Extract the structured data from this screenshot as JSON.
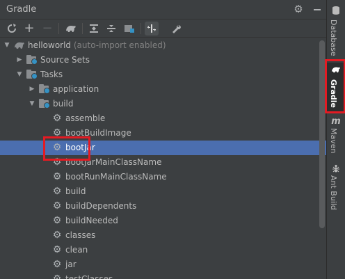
{
  "panel": {
    "title": "Gradle"
  },
  "toolbar": {
    "buttons": [
      {
        "name": "refresh-icon",
        "glyph": "⟳"
      },
      {
        "name": "add-icon",
        "glyph": "+"
      },
      {
        "name": "remove-icon",
        "glyph": "−"
      },
      {
        "name": "execute-task-icon",
        "glyph": "🐘"
      },
      {
        "name": "expand-all-icon",
        "glyph": "⇕"
      },
      {
        "name": "collapse-all-icon",
        "glyph": "⇔"
      },
      {
        "name": "group-modules-icon",
        "glyph": "▦"
      },
      {
        "name": "toggle-offline-icon",
        "glyph": "⇆"
      },
      {
        "name": "wrench-icon",
        "glyph": "🔧"
      }
    ]
  },
  "tree": {
    "project": {
      "label": "helloworld",
      "note": "(auto-import enabled)"
    },
    "source_sets": "Source Sets",
    "tasks": "Tasks",
    "application": "application",
    "build": "build",
    "build_tasks": [
      "assemble",
      "bootBuildImage",
      "bootJar",
      "bootJarMainClassName",
      "bootRunMainClassName",
      "build",
      "buildDependents",
      "buildNeeded",
      "classes",
      "clean",
      "jar",
      "testClasses"
    ],
    "selected_task": "bootJar"
  },
  "sidebar": {
    "tabs": [
      {
        "label": "Database",
        "active": false
      },
      {
        "label": "Gradle",
        "active": true
      },
      {
        "label": "Maven",
        "active": false
      },
      {
        "label": "Ant Build",
        "active": false
      }
    ]
  },
  "colors": {
    "selection": "#4b6eaf",
    "highlight_box": "#e31b23",
    "panel_bg": "#3c3f41"
  }
}
